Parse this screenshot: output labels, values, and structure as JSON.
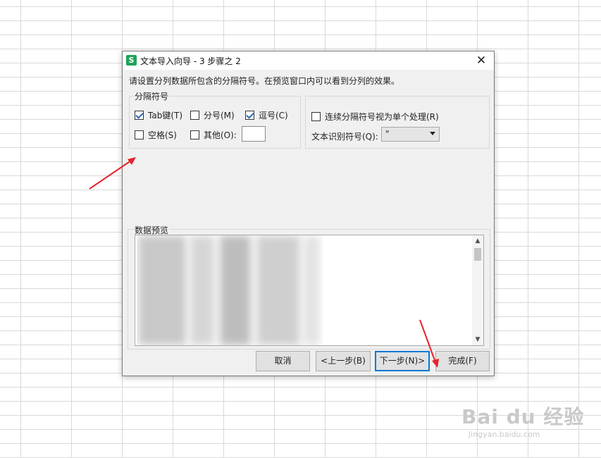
{
  "dialog": {
    "icon_letter": "S",
    "title": "文本导入向导 - 3 步骤之 2",
    "close_glyph": "✕",
    "instruction": "请设置分列数据所包含的分隔符号。在预览窗口内可以看到分列的效果。",
    "delimiters": {
      "group_label": "分隔符号",
      "tab": {
        "label": "Tab键(T)",
        "checked": true
      },
      "semicolon": {
        "label": "分号(M)",
        "checked": false
      },
      "comma": {
        "label": "逗号(C)",
        "checked": true
      },
      "space": {
        "label": "空格(S)",
        "checked": false
      },
      "other": {
        "label": "其他(O):",
        "checked": false,
        "value": ""
      }
    },
    "options": {
      "consecutive": {
        "label": "连续分隔符号视为单个处理(R)",
        "checked": false
      },
      "text_qualifier_label": "文本识别符号(Q):",
      "text_qualifier_value": "\""
    },
    "preview": {
      "label": "数据预览"
    },
    "buttons": {
      "cancel": "取消",
      "back": "<上一步(B)",
      "next": "下一步(N)>",
      "finish": "完成(F)"
    }
  },
  "watermark": {
    "main": "Bai du 经验",
    "sub": "jingyan.baidu.com"
  },
  "colors": {
    "annotation_arrow": "#e8202a",
    "check_mark": "#2b6cb3",
    "app_icon": "#1fa35a",
    "default_button_border": "#0078d7"
  }
}
